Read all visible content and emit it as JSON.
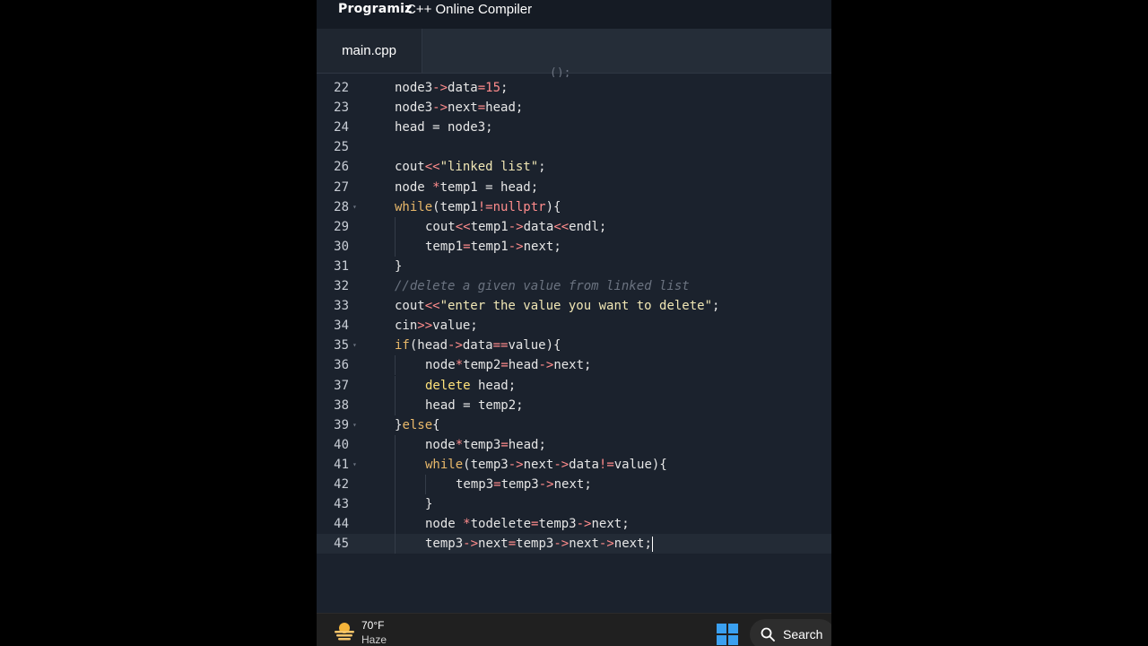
{
  "header": {
    "brand": "Programiz",
    "title": "C++ Online Compiler"
  },
  "tabs": [
    {
      "label": "main.cpp"
    }
  ],
  "editor": {
    "partial_top": "();",
    "lines": [
      {
        "n": "22",
        "indent": 0,
        "fold": false,
        "active": false,
        "tokens": [
          [
            "node3",
            "plain"
          ],
          [
            "->",
            "op"
          ],
          [
            "data",
            "plain"
          ],
          [
            "=",
            "op"
          ],
          [
            "15",
            "num"
          ],
          [
            ";",
            "plain"
          ]
        ]
      },
      {
        "n": "23",
        "indent": 0,
        "fold": false,
        "active": false,
        "tokens": [
          [
            "node3",
            "plain"
          ],
          [
            "->",
            "op"
          ],
          [
            "next",
            "plain"
          ],
          [
            "=",
            "op"
          ],
          [
            "head;",
            "plain"
          ]
        ]
      },
      {
        "n": "24",
        "indent": 0,
        "fold": false,
        "active": false,
        "tokens": [
          [
            "head = node3;",
            "plain"
          ]
        ]
      },
      {
        "n": "25",
        "indent": 0,
        "fold": false,
        "active": false,
        "tokens": []
      },
      {
        "n": "26",
        "indent": 0,
        "fold": false,
        "active": false,
        "tokens": [
          [
            "cout",
            "plain"
          ],
          [
            "<<",
            "op"
          ],
          [
            "\"linked list\"",
            "str"
          ],
          [
            ";",
            "plain"
          ]
        ]
      },
      {
        "n": "27",
        "indent": 0,
        "fold": false,
        "active": false,
        "tokens": [
          [
            "node ",
            "plain"
          ],
          [
            "*",
            "op"
          ],
          [
            "temp1 = head;",
            "plain"
          ]
        ]
      },
      {
        "n": "28",
        "indent": 0,
        "fold": true,
        "active": false,
        "tokens": [
          [
            "while",
            "kw"
          ],
          [
            "(temp1",
            "plain"
          ],
          [
            "!=",
            "op"
          ],
          [
            "nullptr",
            "op"
          ],
          [
            "){",
            "plain"
          ]
        ]
      },
      {
        "n": "29",
        "indent": 1,
        "fold": false,
        "active": false,
        "tokens": [
          [
            "cout",
            "plain"
          ],
          [
            "<<",
            "op"
          ],
          [
            "temp1",
            "plain"
          ],
          [
            "->",
            "op"
          ],
          [
            "data",
            "plain"
          ],
          [
            "<<",
            "op"
          ],
          [
            "endl;",
            "plain"
          ]
        ]
      },
      {
        "n": "30",
        "indent": 1,
        "fold": false,
        "active": false,
        "tokens": [
          [
            "temp1",
            "plain"
          ],
          [
            "=",
            "op"
          ],
          [
            "temp1",
            "plain"
          ],
          [
            "->",
            "op"
          ],
          [
            "next;",
            "plain"
          ]
        ]
      },
      {
        "n": "31",
        "indent": 0,
        "fold": false,
        "active": false,
        "tokens": [
          [
            "}",
            "plain"
          ]
        ]
      },
      {
        "n": "32",
        "indent": 0,
        "fold": false,
        "active": false,
        "tokens": [
          [
            "//delete a given value from linked list",
            "com"
          ]
        ]
      },
      {
        "n": "33",
        "indent": 0,
        "fold": false,
        "active": false,
        "tokens": [
          [
            "cout",
            "plain"
          ],
          [
            "<<",
            "op"
          ],
          [
            "\"enter the value you want to delete\"",
            "str"
          ],
          [
            ";",
            "plain"
          ]
        ]
      },
      {
        "n": "34",
        "indent": 0,
        "fold": false,
        "active": false,
        "tokens": [
          [
            "cin",
            "plain"
          ],
          [
            ">>",
            "op"
          ],
          [
            "value;",
            "plain"
          ]
        ]
      },
      {
        "n": "35",
        "indent": 0,
        "fold": true,
        "active": false,
        "tokens": [
          [
            "if",
            "kw"
          ],
          [
            "(head",
            "plain"
          ],
          [
            "->",
            "op"
          ],
          [
            "data",
            "plain"
          ],
          [
            "==",
            "op"
          ],
          [
            "value){",
            "plain"
          ]
        ]
      },
      {
        "n": "36",
        "indent": 1,
        "fold": false,
        "active": false,
        "tokens": [
          [
            "node",
            "plain"
          ],
          [
            "*",
            "op"
          ],
          [
            "temp2",
            "plain"
          ],
          [
            "=",
            "op"
          ],
          [
            "head",
            "plain"
          ],
          [
            "->",
            "op"
          ],
          [
            "next;",
            "plain"
          ]
        ]
      },
      {
        "n": "37",
        "indent": 1,
        "fold": false,
        "active": false,
        "tokens": [
          [
            "delete",
            "kw2"
          ],
          [
            " head;",
            "plain"
          ]
        ]
      },
      {
        "n": "38",
        "indent": 1,
        "fold": false,
        "active": false,
        "tokens": [
          [
            "head = temp2;",
            "plain"
          ]
        ]
      },
      {
        "n": "39",
        "indent": 0,
        "fold": true,
        "active": false,
        "tokens": [
          [
            "}",
            "plain"
          ],
          [
            "else",
            "kw"
          ],
          [
            "{",
            "plain"
          ]
        ]
      },
      {
        "n": "40",
        "indent": 1,
        "fold": false,
        "active": false,
        "tokens": [
          [
            "node",
            "plain"
          ],
          [
            "*",
            "op"
          ],
          [
            "temp3",
            "plain"
          ],
          [
            "=",
            "op"
          ],
          [
            "head;",
            "plain"
          ]
        ]
      },
      {
        "n": "41",
        "indent": 1,
        "fold": true,
        "active": false,
        "tokens": [
          [
            "while",
            "kw"
          ],
          [
            "(temp3",
            "plain"
          ],
          [
            "->",
            "op"
          ],
          [
            "next",
            "plain"
          ],
          [
            "->",
            "op"
          ],
          [
            "data",
            "plain"
          ],
          [
            "!=",
            "op"
          ],
          [
            "value){",
            "plain"
          ]
        ]
      },
      {
        "n": "42",
        "indent": 2,
        "fold": false,
        "active": false,
        "tokens": [
          [
            "temp3",
            "plain"
          ],
          [
            "=",
            "op"
          ],
          [
            "temp3",
            "plain"
          ],
          [
            "->",
            "op"
          ],
          [
            "next;",
            "plain"
          ]
        ]
      },
      {
        "n": "43",
        "indent": 1,
        "fold": false,
        "active": false,
        "tokens": [
          [
            "}",
            "plain"
          ]
        ]
      },
      {
        "n": "44",
        "indent": 1,
        "fold": false,
        "active": false,
        "tokens": [
          [
            "node ",
            "plain"
          ],
          [
            "*",
            "op"
          ],
          [
            "todelete",
            "plain"
          ],
          [
            "=",
            "op"
          ],
          [
            "temp3",
            "plain"
          ],
          [
            "->",
            "op"
          ],
          [
            "next;",
            "plain"
          ]
        ]
      },
      {
        "n": "45",
        "indent": 1,
        "fold": false,
        "active": true,
        "tokens": [
          [
            "temp3",
            "plain"
          ],
          [
            "->",
            "op"
          ],
          [
            "next",
            "plain"
          ],
          [
            "=",
            "op"
          ],
          [
            "temp3",
            "plain"
          ],
          [
            "->",
            "op"
          ],
          [
            "next",
            "plain"
          ],
          [
            "->",
            "op"
          ],
          [
            "next;",
            "plain"
          ]
        ]
      }
    ]
  },
  "taskbar": {
    "weather_temp": "70°F",
    "weather_desc": "Haze",
    "search_label": "Search",
    "start_icon": "windows-start-icon",
    "search_icon": "search-icon"
  },
  "colors": {
    "background": "#1b222d",
    "operator": "#ff8c8c",
    "string": "#f0e6b4",
    "keyword": "#e8b86a",
    "comment": "#6b7380"
  }
}
